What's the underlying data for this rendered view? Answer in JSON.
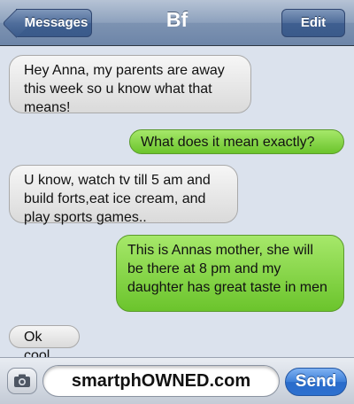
{
  "navbar": {
    "back_label": "Messages",
    "title": "Bf",
    "edit_label": "Edit"
  },
  "messages": [
    {
      "side": "received",
      "text": "Hey Anna, my parents are away this week so u know what that means!"
    },
    {
      "side": "sent",
      "text": "What does it mean exactly?"
    },
    {
      "side": "received",
      "text": "U know, watch tv till 5 am and build forts,eat ice cream, and play sports games.."
    },
    {
      "side": "sent",
      "text": "This is Annas mother, she will be there at 8 pm and my daughter has great taste in men"
    },
    {
      "side": "received",
      "text": "Ok cool"
    }
  ],
  "composer": {
    "field_text": "smartphOWNED.com",
    "send_label": "Send",
    "camera_icon": "camera-icon"
  },
  "colors": {
    "sent_bubble": "#8ed84e",
    "received_bubble": "#e6e6e6",
    "navbar": "#8da1bd",
    "send_button": "#3d7fd8"
  }
}
